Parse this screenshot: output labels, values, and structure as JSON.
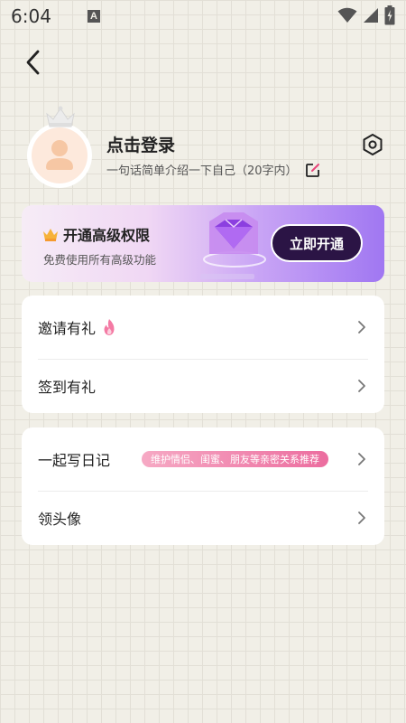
{
  "status_bar": {
    "time": "6:04",
    "notification_glyph": "A"
  },
  "profile": {
    "title": "点击登录",
    "intro": "一句话简单介绍一下自己（20字内）"
  },
  "vip": {
    "title": "开通高级权限",
    "subtitle": "免费使用所有高级功能",
    "button_label": "立即开通"
  },
  "menu_group_1": [
    {
      "label": "邀请有礼"
    },
    {
      "label": "签到有礼"
    }
  ],
  "menu_group_2": [
    {
      "label": "一起写日记",
      "tag": "维护情侣、闺蜜、朋友等亲密关系推荐"
    },
    {
      "label": "领头像"
    }
  ],
  "colors": {
    "background": "#f1efe7",
    "vip_button": "#2b1445",
    "tag_gradient_end": "#ec6d9f",
    "flame": "#f47aa4"
  },
  "icons": [
    "back-icon",
    "crown-icon",
    "avatar-icon",
    "settings-icon",
    "edit-icon",
    "vip-crown-icon",
    "diamond-icon",
    "flame-icon",
    "chevron-right-icon",
    "wifi-icon",
    "signal-icon",
    "battery-icon"
  ]
}
